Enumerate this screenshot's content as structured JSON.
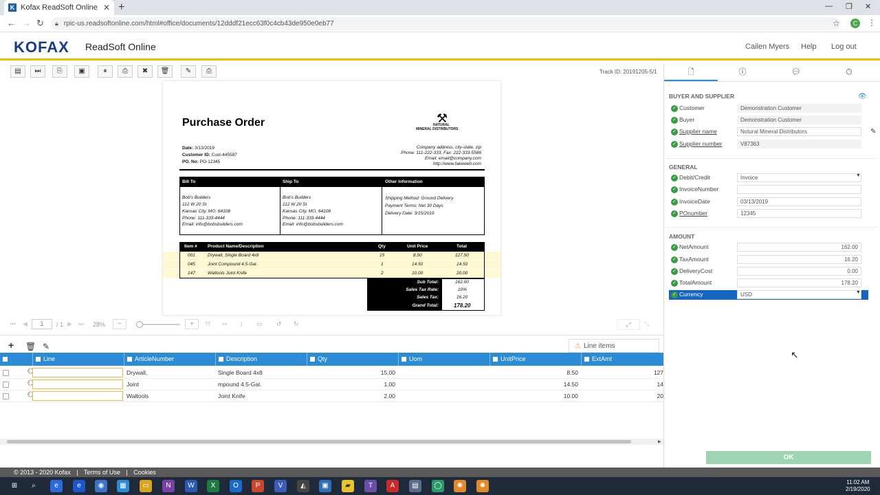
{
  "browser": {
    "tab_title": "Kofax ReadSoft Online",
    "favicon_letter": "K",
    "url": "rpic-us.readsoftonline.com/html#office/documents/12dddf21ecc63f0c4cb43de950e0eb77",
    "profile_letter": "C"
  },
  "app": {
    "logo": "KOFAX",
    "name": "ReadSoft Online",
    "user": "Cailen Myers",
    "help": "Help",
    "logout": "Log out",
    "track_id": "Track ID: 20191205-5/1"
  },
  "document": {
    "title": "Purchase Order",
    "company_name_line1": "NATURAL",
    "company_name_line2": "MINERAL DISTRIBUTORS",
    "date_label": "Date:",
    "date": "3/13/2019",
    "customer_label": "Customer ID:",
    "customer_id": "Cust-445587",
    "po_label": "PO. No:",
    "po": "PO-12345",
    "company_address": "Company address, city-state, zip",
    "phone_line": "Phone: 111-222-333, Fax: 222-333-5586",
    "email_line": "Email: email@company.com",
    "web_line": "http://www.fakeweb.com",
    "bill_to_header": "Bill To",
    "ship_to_header": "Ship To",
    "other_header": "Other Information",
    "bill_to": [
      "Bob's Builders",
      "112 W 20 St",
      "Kansas City, MO, 64108",
      "Phone: 111-333-4444",
      "Email: info@bobsbuilders.com"
    ],
    "ship_to": [
      "Bob's Builders",
      "112 W 20 St",
      "Kansas City, MO, 64108",
      "Phone: 111-333-4444",
      "Email: info@bobsbuilders.com"
    ],
    "other": [
      "Shipping Method: Ground Delivery",
      "Payment Terms: Net 30 Days",
      "Delivery Date: 3/15/2019"
    ],
    "items_headers": [
      "Item #",
      "Product Name/Description",
      "Qty",
      "Unit Price",
      "Total"
    ],
    "items": [
      {
        "item": "001",
        "desc": "Drywall, Single Board 4x8",
        "qty": "15",
        "price": "8.50",
        "total": "127.50"
      },
      {
        "item": "045",
        "desc": "Joint Compound 4.5-Gal.",
        "qty": "1",
        "price": "14.50",
        "total": "14.50"
      },
      {
        "item": "147",
        "desc": "Waltools Joint Knife",
        "qty": "2",
        "price": "10.00",
        "total": "20.00"
      }
    ],
    "summary": [
      {
        "label": "Sub Total:",
        "value": "162.00"
      },
      {
        "label": "Sales Tax Rate:",
        "value": "10%"
      },
      {
        "label": "Sales Tax:",
        "value": "16.20"
      },
      {
        "label": "Grand Total:",
        "value": "178.20"
      }
    ]
  },
  "pagenav": {
    "page": "1",
    "of": "/ 1",
    "zoom": "28%"
  },
  "line_items": {
    "tab_label": "Line items",
    "headers": [
      "Line",
      "ArticleNumber",
      "Description",
      "Qty",
      "Uom",
      "UnitPrice",
      "ExtAmt"
    ],
    "rows": [
      {
        "article": "Drywall,",
        "desc": "Single Board 4x8",
        "qty": "15.00",
        "uom": "",
        "unit": "8.50",
        "ext": "127"
      },
      {
        "article": "Joint",
        "desc": "mpound 4.5-Gal.",
        "qty": "1.00",
        "uom": "",
        "unit": "14.50",
        "ext": "14"
      },
      {
        "article": "Waltools",
        "desc": "Joint Knife",
        "qty": "2.00",
        "uom": "",
        "unit": "10.00",
        "ext": "20"
      }
    ]
  },
  "panel": {
    "sections": {
      "buyer": "BUYER AND SUPPLIER",
      "general": "GENERAL",
      "amount": "AMOUNT"
    },
    "fields": {
      "customer": {
        "label": "Customer",
        "value": "Demonstration Customer"
      },
      "buyer": {
        "label": "Buyer",
        "value": "Demonstration Customer"
      },
      "supplier_name": {
        "label": "Supplier name",
        "value": "Notural Mineral Distributors"
      },
      "supplier_number": {
        "label": "Supplier number",
        "value": "V87363"
      },
      "debit_credit": {
        "label": "Debit/Credit",
        "value": "Invoice"
      },
      "invoice_number": {
        "label": "InvoiceNumber",
        "value": ""
      },
      "invoice_date": {
        "label": "InvoiceDate",
        "value": "03/13/2019"
      },
      "po_number": {
        "label": "POnumber",
        "value": "12345"
      },
      "net_amount": {
        "label": "NetAmount",
        "value": "162.00"
      },
      "tax_amount": {
        "label": "TaxAmount",
        "value": "16.20"
      },
      "delivery_cost": {
        "label": "DeliveryCost",
        "value": "0.00"
      },
      "total_amount": {
        "label": "TotalAmount",
        "value": "178.20"
      },
      "currency": {
        "label": "Currency",
        "value": "USD"
      }
    },
    "ok": "OK"
  },
  "footer": {
    "copyright": "© 2013 - 2020 Kofax",
    "terms": "Terms of Use",
    "sep": "|",
    "cookies": "Cookies"
  },
  "taskbar": {
    "time": "11:02 AM",
    "date": "2/19/2020"
  },
  "colors": {
    "accent": "#2b8bd4",
    "ok_green": "#3a9b45",
    "header_border": "#f0c000",
    "selected": "#1565c0"
  }
}
